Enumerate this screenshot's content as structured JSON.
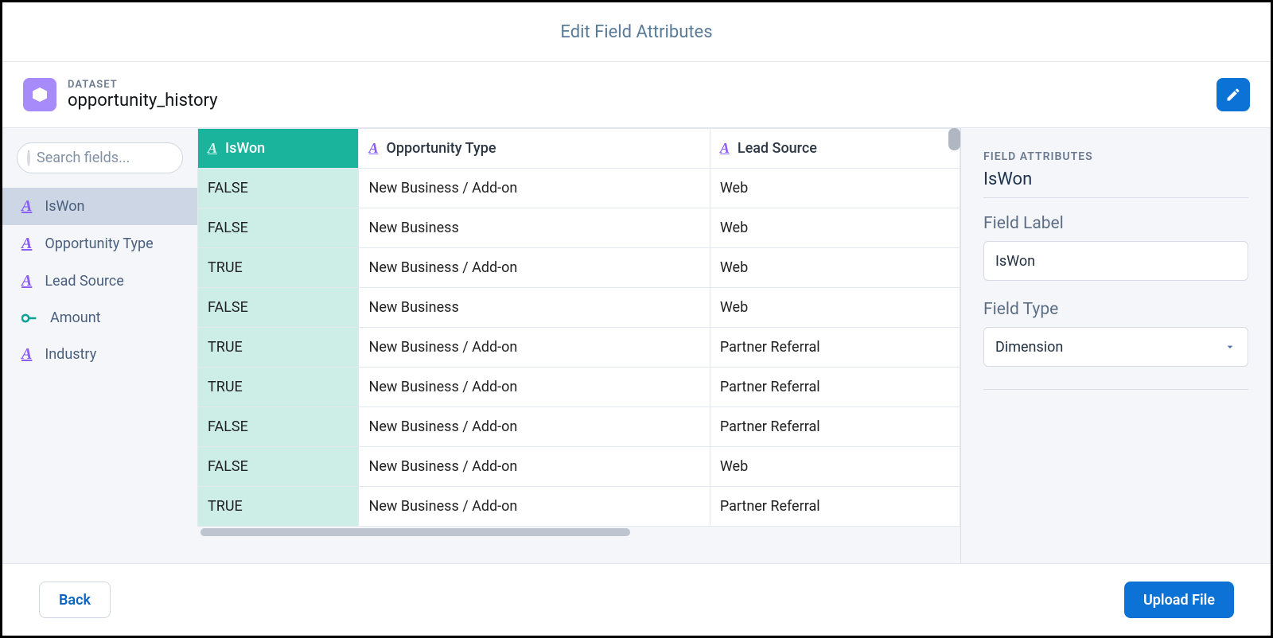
{
  "modal": {
    "title": "Edit Field Attributes"
  },
  "dataset": {
    "label": "DATASET",
    "name": "opportunity_history"
  },
  "search": {
    "placeholder": "Search fields..."
  },
  "fields": [
    {
      "name": "IsWon",
      "type": "dimension",
      "selected": true
    },
    {
      "name": "Opportunity Type",
      "type": "dimension",
      "selected": false
    },
    {
      "name": "Lead Source",
      "type": "dimension",
      "selected": false
    },
    {
      "name": "Amount",
      "type": "measure",
      "selected": false
    },
    {
      "name": "Industry",
      "type": "dimension",
      "selected": false
    }
  ],
  "preview": {
    "columns": [
      {
        "name": "IsWon",
        "type": "dimension",
        "active": true
      },
      {
        "name": "Opportunity Type",
        "type": "dimension",
        "active": false
      },
      {
        "name": "Lead Source",
        "type": "dimension",
        "active": false
      }
    ],
    "rows": [
      [
        "FALSE",
        "New Business / Add-on",
        "Web"
      ],
      [
        "FALSE",
        "New Business",
        "Web"
      ],
      [
        "TRUE",
        "New Business / Add-on",
        "Web"
      ],
      [
        "FALSE",
        "New Business",
        "Web"
      ],
      [
        "TRUE",
        "New Business / Add-on",
        "Partner Referral"
      ],
      [
        "TRUE",
        "New Business / Add-on",
        "Partner Referral"
      ],
      [
        "FALSE",
        "New Business / Add-on",
        "Partner Referral"
      ],
      [
        "FALSE",
        "New Business / Add-on",
        "Web"
      ],
      [
        "TRUE",
        "New Business / Add-on",
        "Partner Referral"
      ]
    ]
  },
  "attributes": {
    "heading": "FIELD ATTRIBUTES",
    "selectedFieldName": "IsWon",
    "fieldLabelLabel": "Field Label",
    "fieldLabelValue": "IsWon",
    "fieldTypeLabel": "Field Type",
    "fieldTypeValue": "Dimension"
  },
  "footer": {
    "back": "Back",
    "upload": "Upload File"
  }
}
